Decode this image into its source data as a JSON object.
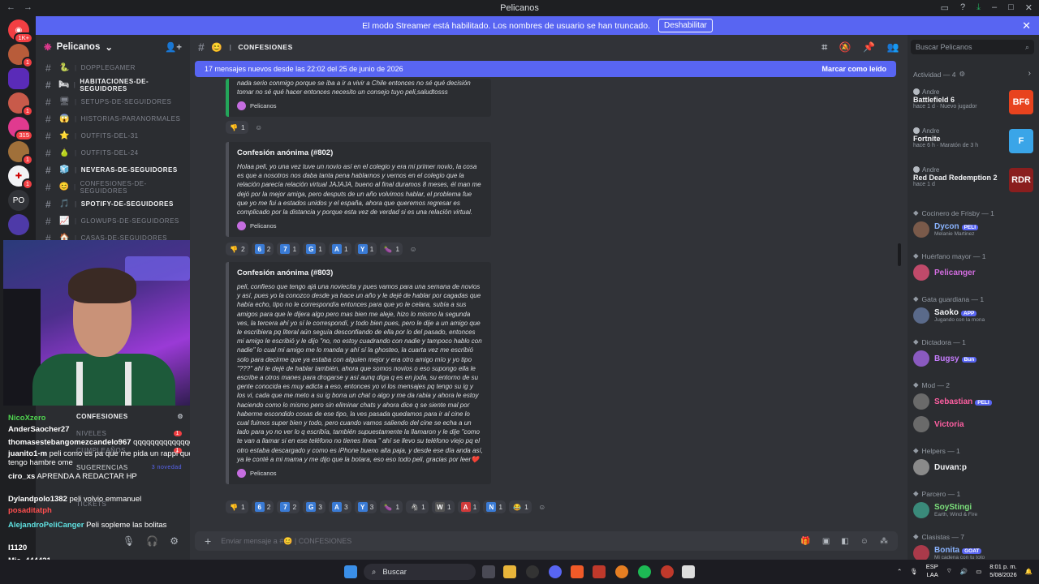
{
  "window": {
    "title": "Pelicanos"
  },
  "streamer": {
    "text": "El modo Streamer está habilitado. Los nombres de usuario se han truncado.",
    "button": "Deshabilitar"
  },
  "servers": [
    {
      "label": "1K+"
    },
    {
      "label": "1"
    },
    {
      "label": ""
    },
    {
      "label": "1"
    },
    {
      "label": "315"
    },
    {
      "label": "1"
    },
    {
      "label": "1"
    },
    {
      "label": "PO"
    },
    {
      "label": ""
    }
  ],
  "guild": {
    "name": "Pelicanos"
  },
  "channels": [
    {
      "emoji": "🐍",
      "name": "DOPPLEGAMER",
      "unread": false
    },
    {
      "emoji": "🛏",
      "name": "HABITACIONES-DE-SEGUIDORES",
      "unread": true
    },
    {
      "emoji": "🖥",
      "name": "SETUPS-DE-SEGUIDORES",
      "unread": false
    },
    {
      "emoji": "😱",
      "name": "HISTORIAS-PARANORMALES",
      "unread": false
    },
    {
      "emoji": "⭐",
      "name": "OUTFITS-DEL-31",
      "unread": false
    },
    {
      "emoji": "🍐",
      "name": "OUTFITS-DEL-24",
      "unread": false
    },
    {
      "emoji": "🧊",
      "name": "NEVERAS-DE-SEGUIDORES",
      "unread": true
    },
    {
      "emoji": "😊",
      "name": "CONFESIONES-DE-SEGUIDORES",
      "unread": false
    },
    {
      "emoji": "🎵",
      "name": "SPOTIFY-DE-SEGUIDORES",
      "unread": true
    },
    {
      "emoji": "📈",
      "name": "GLOWUPS-DE-SEGUIDORES",
      "unread": false
    },
    {
      "emoji": "🏠",
      "name": "CASAS-DE-SEGUIDORES",
      "unread": false
    }
  ],
  "lower_channels": {
    "confesiones": "CONFESIONES",
    "niveles": "NIVELES",
    "cumpleanos": "CUMPLEAÑOS",
    "sugerencias": "SUGERENCIAS",
    "sugerencias_badge": "3 novedad",
    "tickets": "TICKETS"
  },
  "stream_chat": [
    {
      "user": "NicoXzero",
      "text": "",
      "color": "#4fd34f"
    },
    {
      "user": "AnderSaocher27",
      "text": "",
      "color": "#ffffff"
    },
    {
      "user": "thomasestebangomezcandelo967",
      "text": "qqqqqqqqqqqqqqqqqqqqqqqqqqqqqqqqqqqqqqqqqqqqqqqqqq",
      "color": "#ffffff"
    },
    {
      "user": "juanito1-m",
      "text": "peli como es pa que me pida un rappi que tengo hambre ome",
      "color": "#ffffff"
    },
    {
      "user": "ciro_xs",
      "text": "APRENDA A REDACTAR HP",
      "color": "#ffffff"
    },
    {
      "user": "Dylandpolo1382",
      "text": "peli volvio emmanuel",
      "color": "#ffffff"
    },
    {
      "user": "posaditatph",
      "text": "",
      "color": "#ff4f4f"
    },
    {
      "user": "AlejandroPeliCanger",
      "text": "Peli sopleme las bolitas",
      "color": "#5fe0e0"
    },
    {
      "user": "I1120",
      "text": "",
      "color": "#ffffff"
    },
    {
      "user": "Mia_444421",
      "text": "",
      "color": "#ffffff"
    },
    {
      "user": "EstebanyMole",
      "text": "Jjajajaajajaj",
      "color": "#ff4f4f"
    }
  ],
  "header": {
    "channel": "CONFESIONES"
  },
  "newbar": {
    "text": "17 mensajes nuevos desde las 22:02 del 25 de junio de 2026",
    "mark": "Marcar como leído"
  },
  "messages": [
    {
      "title": "",
      "body": "nada serio conmigo porque se iba a ir a vivir a Chile entonces no sé qué decisión tomar no sé qué hacer entonces necesito un consejo tuyo peli,saludtosss",
      "author": "Pelicanos",
      "reactions": [
        {
          "e": "👎",
          "n": "1"
        }
      ]
    },
    {
      "title": "Confesión anónima (#802)",
      "body": "Holaa peli, yo una vez tuve un novio así en el colegio y era mi primer novio, la cosa es que a nosotros nos daba tanta pena hablarnos y vernos en el colegio que la relación parecía relación virtual JAJAJA, bueno al final duramos 8 meses, él man me dejó por la mejor amiga, pero desputs de un año volvimos hablar, el problema fue que yo me fui a estados unidos y el españa, ahora que queremos regresar es complicado por la distancia y porque esta vez de verdad si es una relación virtual.",
      "author": "Pelicanos",
      "reactions": [
        {
          "e": "👎",
          "n": "2"
        },
        {
          "e": "6",
          "n": "2"
        },
        {
          "e": "7",
          "n": "1"
        },
        {
          "e": "G",
          "n": "1"
        },
        {
          "e": "A",
          "n": "1"
        },
        {
          "e": "Y",
          "n": "1"
        },
        {
          "e": "🍆",
          "n": "1"
        }
      ]
    },
    {
      "title": "Confesión anónima (#803)",
      "body": "peli, confieso que tengo ajá una noviecita y pues vamos para una semana de novios y así, pues yo la conozco desde ya hace un año y le dejé de hablar por cagadas que había echo, tipo no le correspondía entonces para que yo le celara, subía a sus amigos para que le dijera algo pero mas bien me aleje, hizo lo mismo la segunda ves, la tercera ahí yo sí le correspondí, y todo bien pues, pero le dije a un amigo que le escribiera pq literal aún seguía desconfiando de ella por lo del pasado, entonces mi amigo le escribió y le dijo \"no, no estoy cuadrando con nadie y tampoco hablo con nadie\" lo cual mi amigo me lo manda y ahí sí la ghosteo, la cuarta vez me escribió solo para decirme que ya estaba con alguien mejor y era otro amigo mío y yo tipo \"???\" ahí le dejé de hablar también, ahora que somos novios o eso supongo ella le escribe a otros manes para drogarse y así aunq diga q es en joda, su entorno de su gente conocida es muy adicta a eso, entonces yo vi los mensajes pq tengo su ig y los vi, cada que me meto a su ig borra un chat o algo y me da rabia y ahora le estoy haciendo como lo mismo pero sin eliminar chats y ahora dice q se siente mal por haberme escondido cosas de ese tipo, la ves pasada quedamos para ir al cine lo cual fuimos super bien y todo, pero cuando vamos saliendo del cine se echa a un lado para yo no ver lo q escribía, también supuestamente la llamaron y le dije \"como te van a llamar si en ese teléfono no tienes línea \" ahí se llevo su teléfono viejo pq el otro estaba descargado y como es iPhone bueno alta paja, y desde ese día anda así, ya le conté a mi mama y me dijo que la botara, eso eso todo peli, gracias por leer❤️",
      "author": "Pelicanos",
      "reactions": [
        {
          "e": "👎",
          "n": "1"
        },
        {
          "e": "6",
          "n": "2"
        },
        {
          "e": "7",
          "n": "2"
        },
        {
          "e": "G",
          "n": "3"
        },
        {
          "e": "A",
          "n": "3"
        },
        {
          "e": "Y",
          "n": "3"
        },
        {
          "e": "🍆",
          "n": "1"
        },
        {
          "e": "🦓",
          "n": "1"
        },
        {
          "e": "W",
          "n": "1"
        },
        {
          "e": "A",
          "n": "1"
        },
        {
          "e": "N",
          "n": "1"
        },
        {
          "e": "😂",
          "n": "1"
        }
      ]
    }
  ],
  "composer": {
    "placeholder": "Enviar mensaje a #😊 | CONFESIONES"
  },
  "members": {
    "search": "Buscar Pelicanos",
    "activity_title": "Actividad — 4",
    "activities": [
      {
        "who": "Andre",
        "game": "Battlefield 6",
        "meta": "hace 1 d  ·  Nuevo jugador",
        "thumb": "BF6",
        "color": "#e8431e"
      },
      {
        "who": "Andre",
        "game": "Fortnite",
        "meta": "hace 6 h  ·  Maratón de 3 h",
        "thumb": "F",
        "color": "#3aa5e8"
      },
      {
        "who": "Andre",
        "game": "Red Dead Redemption 2",
        "meta": "hace 1 d",
        "thumb": "RDR",
        "color": "#8a1e1e"
      }
    ],
    "groups": [
      {
        "title": "Cocinero de Frisby — 1",
        "members": [
          {
            "name": "Dycon",
            "tag": "PELI",
            "sub": "Melanie Martinez",
            "color": "#8ab4ff"
          }
        ]
      },
      {
        "title": "Huérfano mayor — 1",
        "members": [
          {
            "name": "Pelicanger",
            "tag": "",
            "sub": "",
            "color": "#d36de0"
          }
        ]
      },
      {
        "title": "Gata guardiana — 1",
        "members": [
          {
            "name": "Saoko",
            "tag": "APP",
            "sub": "Jugando con la mona",
            "color": "#f2f3f5"
          }
        ]
      },
      {
        "title": "Dictadora — 1",
        "members": [
          {
            "name": "Bugsy",
            "tag": "Bun",
            "sub": "",
            "color": "#c77dff"
          }
        ]
      },
      {
        "title": "Mod — 2",
        "members": [
          {
            "name": "Sebastian",
            "tag": "PELI",
            "sub": "",
            "color": "#ff5fa2"
          },
          {
            "name": "Victoria",
            "tag": "",
            "sub": "",
            "color": "#ff5fa2"
          }
        ]
      },
      {
        "title": "Helpers — 1",
        "members": [
          {
            "name": "Duvan:p",
            "tag": "",
            "sub": "",
            "color": "#f2f3f5"
          }
        ]
      },
      {
        "title": "Parcero — 1",
        "members": [
          {
            "name": "SoyStingi",
            "tag": "",
            "sub": "Earth, Wind & Fire",
            "color": "#7be07b"
          }
        ]
      },
      {
        "title": "Clasistas — 7",
        "members": [
          {
            "name": "Bonita",
            "tag": "GOAT",
            "sub": "Mi cadena con tu toto",
            "color": "#8ab4ff"
          }
        ]
      }
    ]
  },
  "taskbar": {
    "search": "Buscar",
    "lang": "ESP",
    "layout": "LAA",
    "time": "8:01 p. m.",
    "date": "5/08/2026"
  }
}
